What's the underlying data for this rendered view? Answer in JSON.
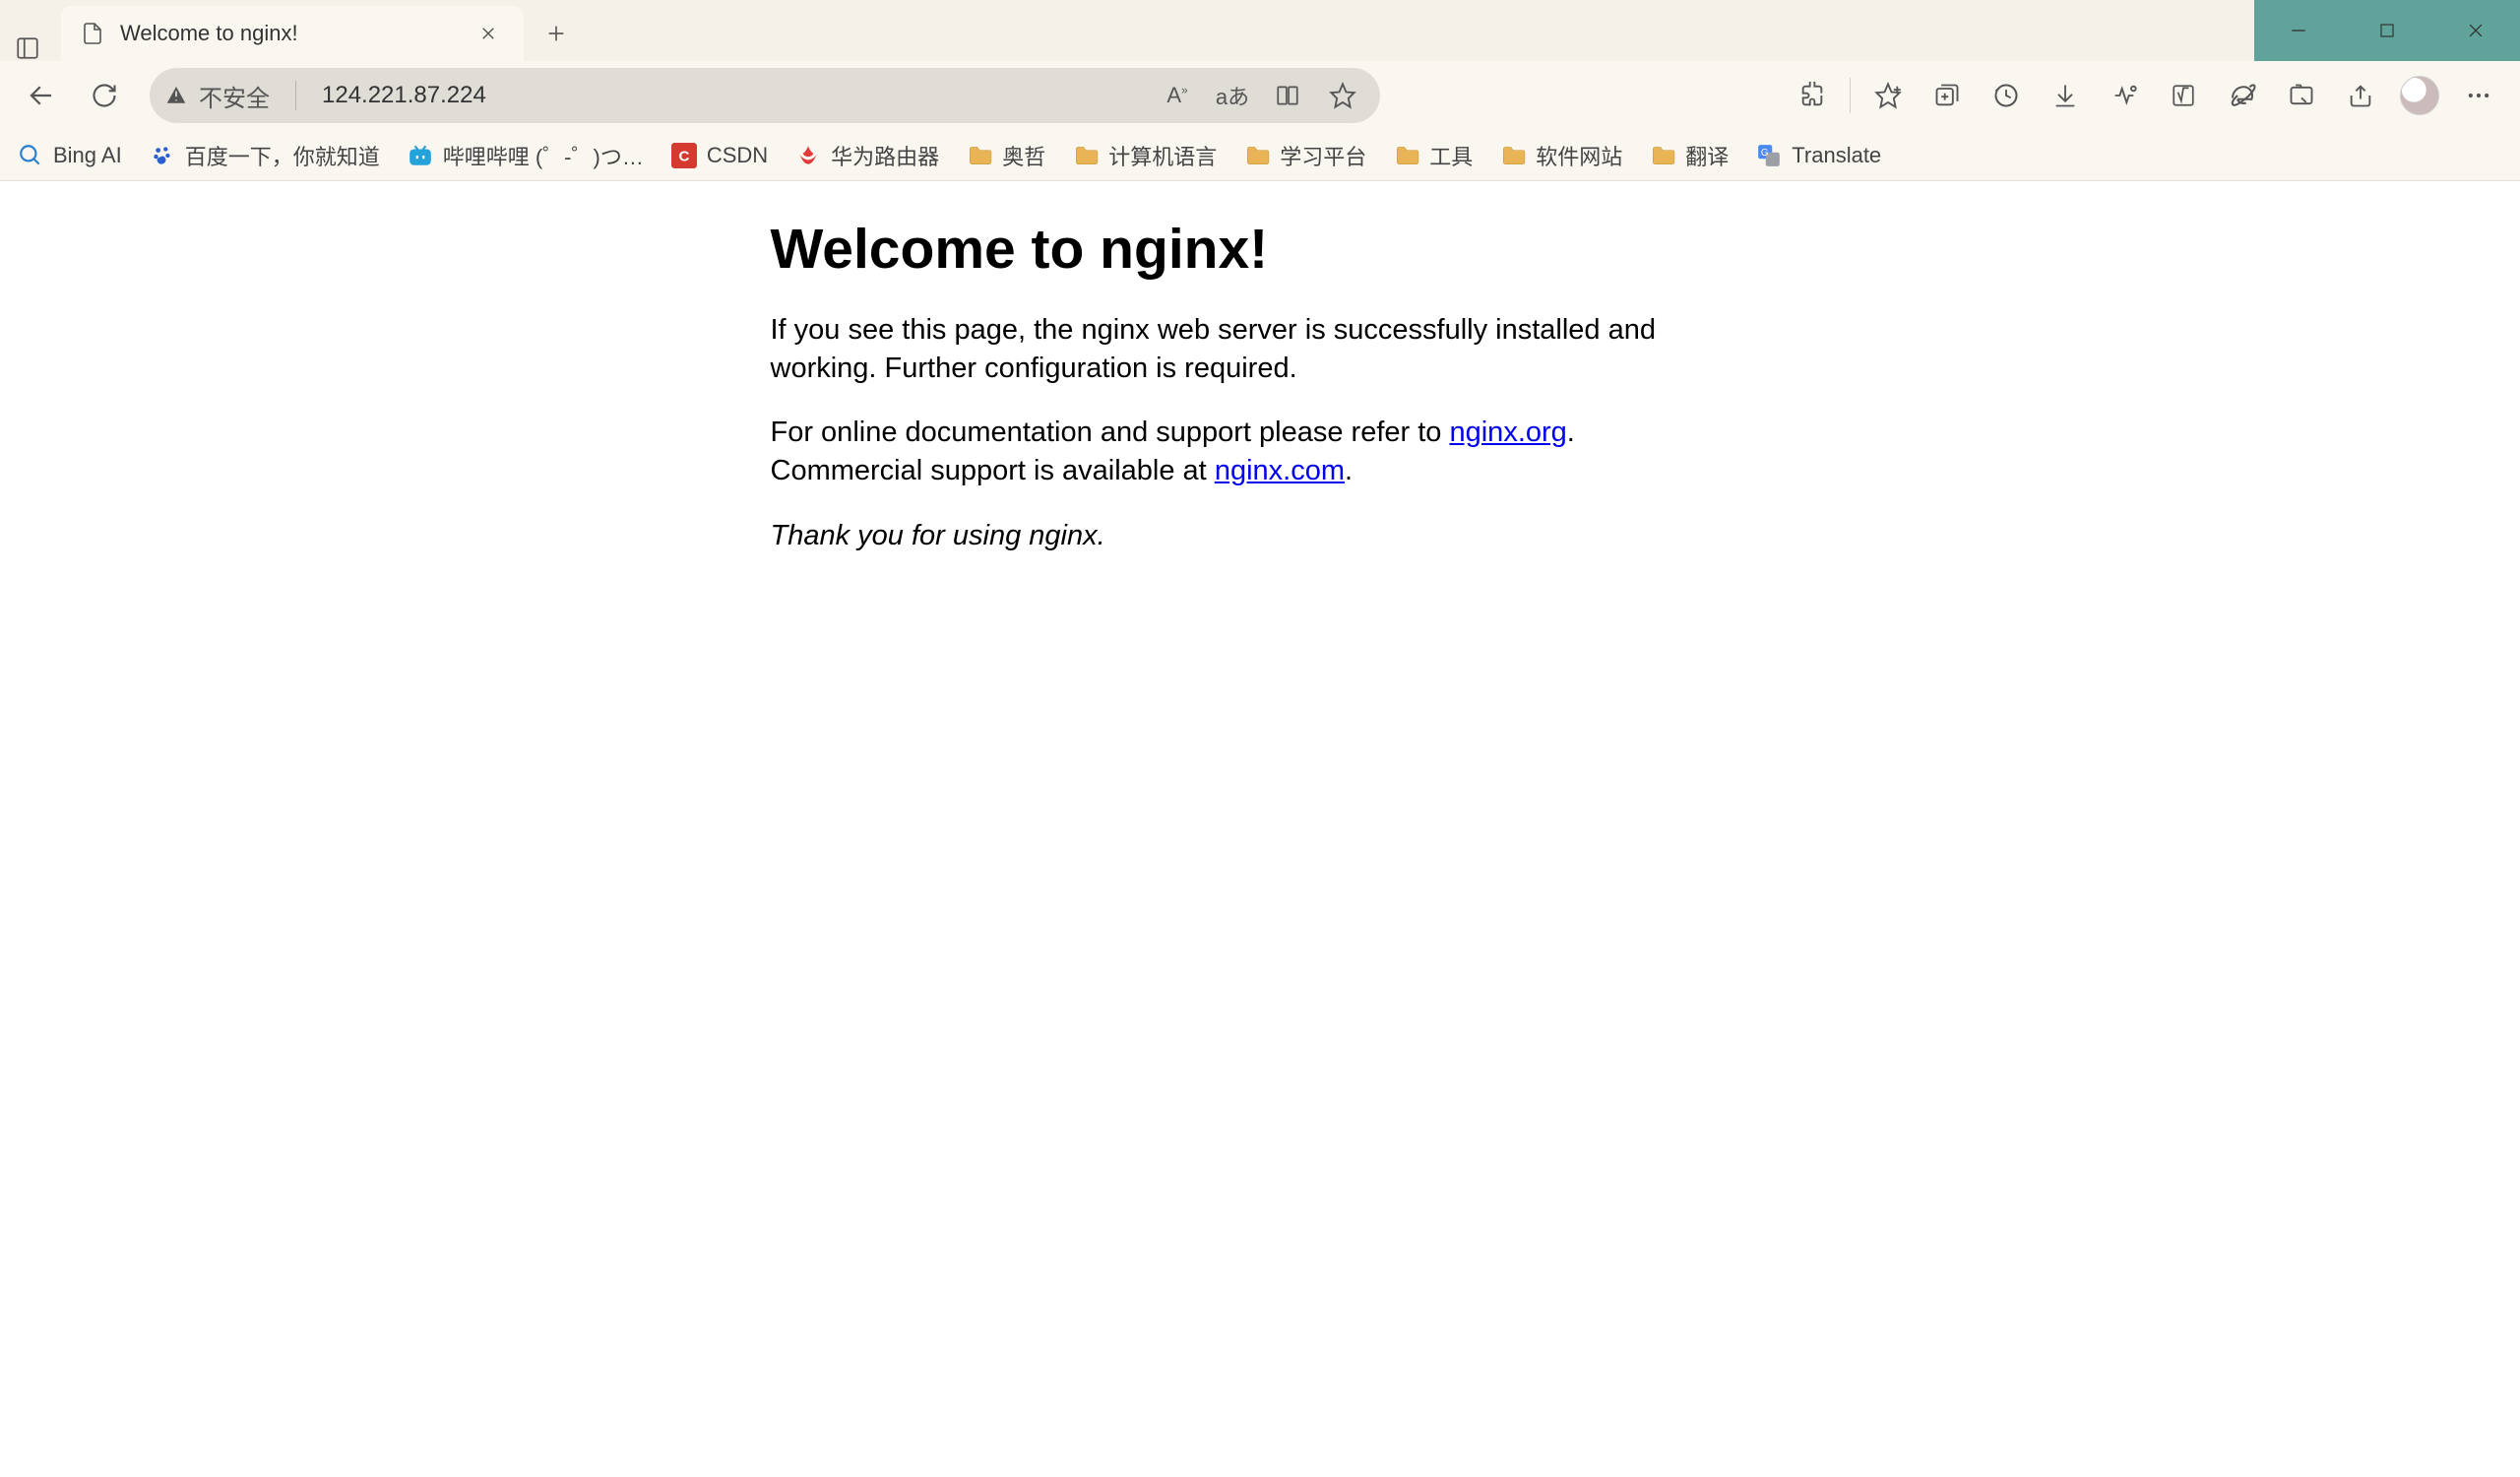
{
  "tab": {
    "title": "Welcome to nginx!"
  },
  "address": {
    "security_label": "不安全",
    "url": "124.221.87.224"
  },
  "bookmarks": [
    {
      "label": "Bing AI",
      "icon": "search"
    },
    {
      "label": "百度一下，你就知道",
      "icon": "baidu"
    },
    {
      "label": "哔哩哔哩 (゜-゜)つ…",
      "icon": "bilibili"
    },
    {
      "label": "CSDN",
      "icon": "csdn"
    },
    {
      "label": "华为路由器",
      "icon": "huawei"
    },
    {
      "label": "奥哲",
      "icon": "folder"
    },
    {
      "label": "计算机语言",
      "icon": "folder"
    },
    {
      "label": "学习平台",
      "icon": "folder"
    },
    {
      "label": "工具",
      "icon": "folder"
    },
    {
      "label": "软件网站",
      "icon": "folder"
    },
    {
      "label": "翻译",
      "icon": "folder"
    },
    {
      "label": "Translate",
      "icon": "gtranslate"
    }
  ],
  "page": {
    "heading": "Welcome to nginx!",
    "para1": "If you see this page, the nginx web server is successfully installed and working. Further configuration is required.",
    "para2_pre": "For online documentation and support please refer to ",
    "link1": "nginx.org",
    "para2_mid": ".",
    "para3_pre": "Commercial support is available at ",
    "link2": "nginx.com",
    "para3_post": ".",
    "thanks": "Thank you for using nginx."
  }
}
